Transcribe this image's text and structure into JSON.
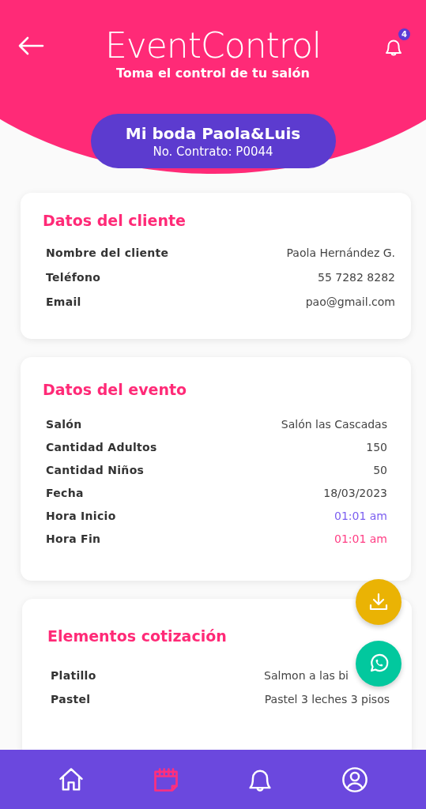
{
  "header": {
    "logo": "EventControl",
    "tagline": "Toma el control de tu salón",
    "notification_count": "4"
  },
  "event": {
    "title": "Mi boda Paola&Luis",
    "contract": "No. Contrato: P0044"
  },
  "cards": [
    {
      "title": "Datos del cliente",
      "rows": [
        {
          "label": "Nombre del cliente",
          "value": "Paola Hernández G."
        },
        {
          "label": "Teléfono",
          "value": "55 7282 8282"
        },
        {
          "label": "Email",
          "value": "pao@gmail.com"
        }
      ]
    },
    {
      "title": "Datos del evento",
      "rows": [
        {
          "label": "Salón",
          "value": "Salón las Cascadas"
        },
        {
          "label": "Cantidad Adultos",
          "value": "150"
        },
        {
          "label": "Cantidad Niños",
          "value": "50"
        },
        {
          "label": "Fecha",
          "value": "18/03/2023"
        },
        {
          "label": "Hora Inicio",
          "value": "01:01 am",
          "color": "#7b5ef0"
        },
        {
          "label": "Hora Fin",
          "value": "01:01 am",
          "color": "#ff3d84"
        }
      ]
    },
    {
      "title": "Elementos cotización",
      "rows": [
        {
          "label": "Platillo",
          "value": "Salmon a las bi"
        },
        {
          "label": "Pastel",
          "value": "Pastel 3 leches 3 pisos"
        }
      ]
    }
  ],
  "bottom_nav": [
    {
      "kind": "home",
      "selected": false
    },
    {
      "kind": "calendar",
      "selected": true
    },
    {
      "kind": "bell",
      "selected": false
    },
    {
      "kind": "profile",
      "selected": false
    }
  ]
}
